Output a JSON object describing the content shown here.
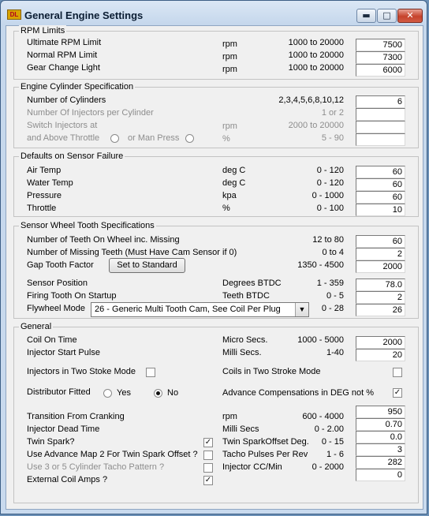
{
  "window": {
    "title": "General Engine Settings",
    "icon_text": "DL",
    "min_glyph": "▬",
    "max_glyph": "□",
    "close_glyph": "✕"
  },
  "rpm_limits": {
    "title": "RPM Limits",
    "rows": [
      {
        "label": "Ultimate RPM Limit",
        "unit": "rpm",
        "range": "1000 to  20000",
        "value": "7500"
      },
      {
        "label": "Normal RPM Limit",
        "unit": "rpm",
        "range": "1000 to  20000",
        "value": "7300"
      },
      {
        "label": "Gear Change Light",
        "unit": "rpm",
        "range": "1000 to  20000",
        "value": "6000"
      }
    ]
  },
  "cylinder": {
    "title": "Engine Cylinder Specification",
    "num_cyl": {
      "label": "Number of Cylinders",
      "range": "2,3,4,5,6,8,10,12",
      "value": "6"
    },
    "inj_per_cyl": {
      "label": "Number Of Injectors per Cylinder",
      "range": "1 or 2",
      "value": ""
    },
    "switch_inj": {
      "label": "Switch Injectors at",
      "unit": "rpm",
      "range": "2000 to 20000",
      "value": ""
    },
    "above_throttle": {
      "label": "and Above Throttle",
      "or_label": "or Man Press",
      "unit": "%",
      "range": "5 - 90",
      "value": ""
    }
  },
  "sensor_failure": {
    "title": "Defaults on Sensor Failure",
    "rows": [
      {
        "label": "Air Temp",
        "unit": "deg C",
        "range": "0 - 120",
        "value": "60"
      },
      {
        "label": "Water Temp",
        "unit": "deg C",
        "range": "0 - 120",
        "value": "60"
      },
      {
        "label": "Pressure",
        "unit": "kpa",
        "range": "0 - 1000",
        "value": "60"
      },
      {
        "label": "Throttle",
        "unit": "%",
        "range": "0 - 100",
        "value": "10"
      }
    ]
  },
  "wheel": {
    "title": "Sensor Wheel Tooth Specifications",
    "teeth": {
      "label": "Number of Teeth On Wheel inc. Missing",
      "range": "12 to 80",
      "value": "60"
    },
    "missing": {
      "label": "Number of Missing Teeth (Must Have Cam Sensor if 0)",
      "range": "0 to 4",
      "value": "2"
    },
    "gap": {
      "label": "Gap Tooth Factor",
      "button": "Set to Standard",
      "range": "1350 - 4500",
      "value": "2000"
    },
    "position": {
      "label": "Sensor Position",
      "unit": "Degrees BTDC",
      "range": "1 - 359",
      "value": "78.0"
    },
    "firing": {
      "label": "Firing Tooth On Startup",
      "unit": "Teeth BTDC",
      "range": "0 - 5",
      "value": "2"
    },
    "flywheel": {
      "label": "Flywheel Mode",
      "selected": "26 - Generic Multi Tooth Cam, See Coil Per Plug",
      "range": "0 - 28",
      "value": "26"
    }
  },
  "general": {
    "title": "General",
    "coil_on": {
      "label": "Coil On Time",
      "unit": "Micro Secs.",
      "range": "1000 - 5000",
      "value": "2000"
    },
    "inj_start": {
      "label": "Injector Start Pulse",
      "unit": "Milli Secs.",
      "range": "1-40",
      "value": "20"
    },
    "inj_two_stroke": {
      "label": "Injectors in Two Stoke Mode",
      "checked": false
    },
    "coils_two_stroke": {
      "label": "Coils in Two Stroke Mode",
      "checked": false
    },
    "distributor": {
      "label": "Distributor Fitted",
      "yes": "Yes",
      "no": "No",
      "selected": "No"
    },
    "advance_comp": {
      "label": "Advance Compensations in DEG not %",
      "checked": true
    },
    "left_rows": [
      {
        "label": "Transition From Cranking",
        "unit": "rpm",
        "range": "600 - 4000"
      },
      {
        "label": "Injector Dead Time",
        "unit": "Milli Secs",
        "range": "0 - 2.00"
      },
      {
        "label": "Twin Spark?",
        "checked": true
      },
      {
        "label": "Use Advance Map 2 For Twin Spark Offset ?",
        "checked": false
      },
      {
        "label": "Use 3 or 5 Cylinder Tacho Pattern ?",
        "checked": false
      },
      {
        "label": "External Coil Amps ?",
        "checked": true
      }
    ],
    "right_rows": [
      {
        "label": "Twin SparkOffset Deg.",
        "range": "0 - 15"
      },
      {
        "label": "Tacho Pulses Per Rev",
        "range": "1 - 6"
      },
      {
        "label": "Injector CC/Min",
        "range": "0 - 2000"
      }
    ],
    "values": [
      "950",
      "0.70",
      "0.0",
      "3",
      "282",
      "0"
    ]
  }
}
